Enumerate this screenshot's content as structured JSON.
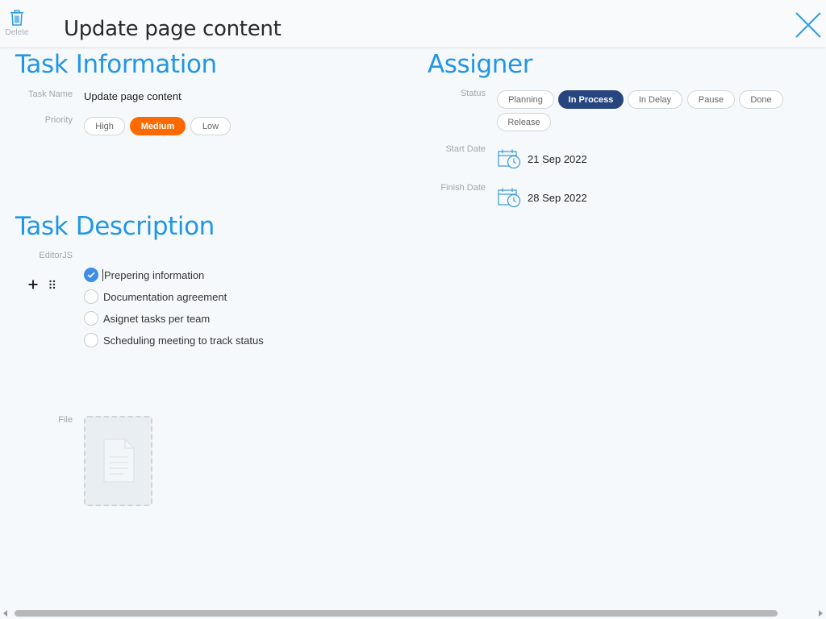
{
  "header": {
    "delete_label": "Delete",
    "title": "Update page content"
  },
  "task_info": {
    "section_title": "Task Information",
    "task_name_label": "Task Name",
    "task_name_value": "Update page content",
    "priority_label": "Priority",
    "priority_options": [
      "High",
      "Medium",
      "Low"
    ],
    "priority_selected": "Medium"
  },
  "assigner": {
    "section_title": "Assigner",
    "status_label": "Status",
    "status_options": [
      "Planning",
      "In Process",
      "In Delay",
      "Pause",
      "Done",
      "Release"
    ],
    "status_selected": "In Process",
    "start_date_label": "Start Date",
    "start_date": "21 Sep 2022",
    "finish_date_label": "Finish Date",
    "finish_date": "28 Sep 2022"
  },
  "task_description": {
    "section_title": "Task Description",
    "editor_label": "EditorJS",
    "checklist": [
      {
        "text": "Prepering information",
        "checked": true
      },
      {
        "text": "Documentation agreement",
        "checked": false
      },
      {
        "text": "Asignet tasks per team",
        "checked": false
      },
      {
        "text": "Scheduling meeting to track status",
        "checked": false
      }
    ],
    "file_label": "File"
  },
  "colors": {
    "accent_blue": "#2196e6",
    "priority_selected": "#ff6a00",
    "status_selected": "#27467f",
    "check_blue": "#3c8ee8"
  },
  "icons": {
    "delete": "trash-icon",
    "close": "close-icon",
    "date": "calendar-clock-icon",
    "add": "plus-icon",
    "drag": "drag-handle-icon",
    "file": "document-icon"
  }
}
